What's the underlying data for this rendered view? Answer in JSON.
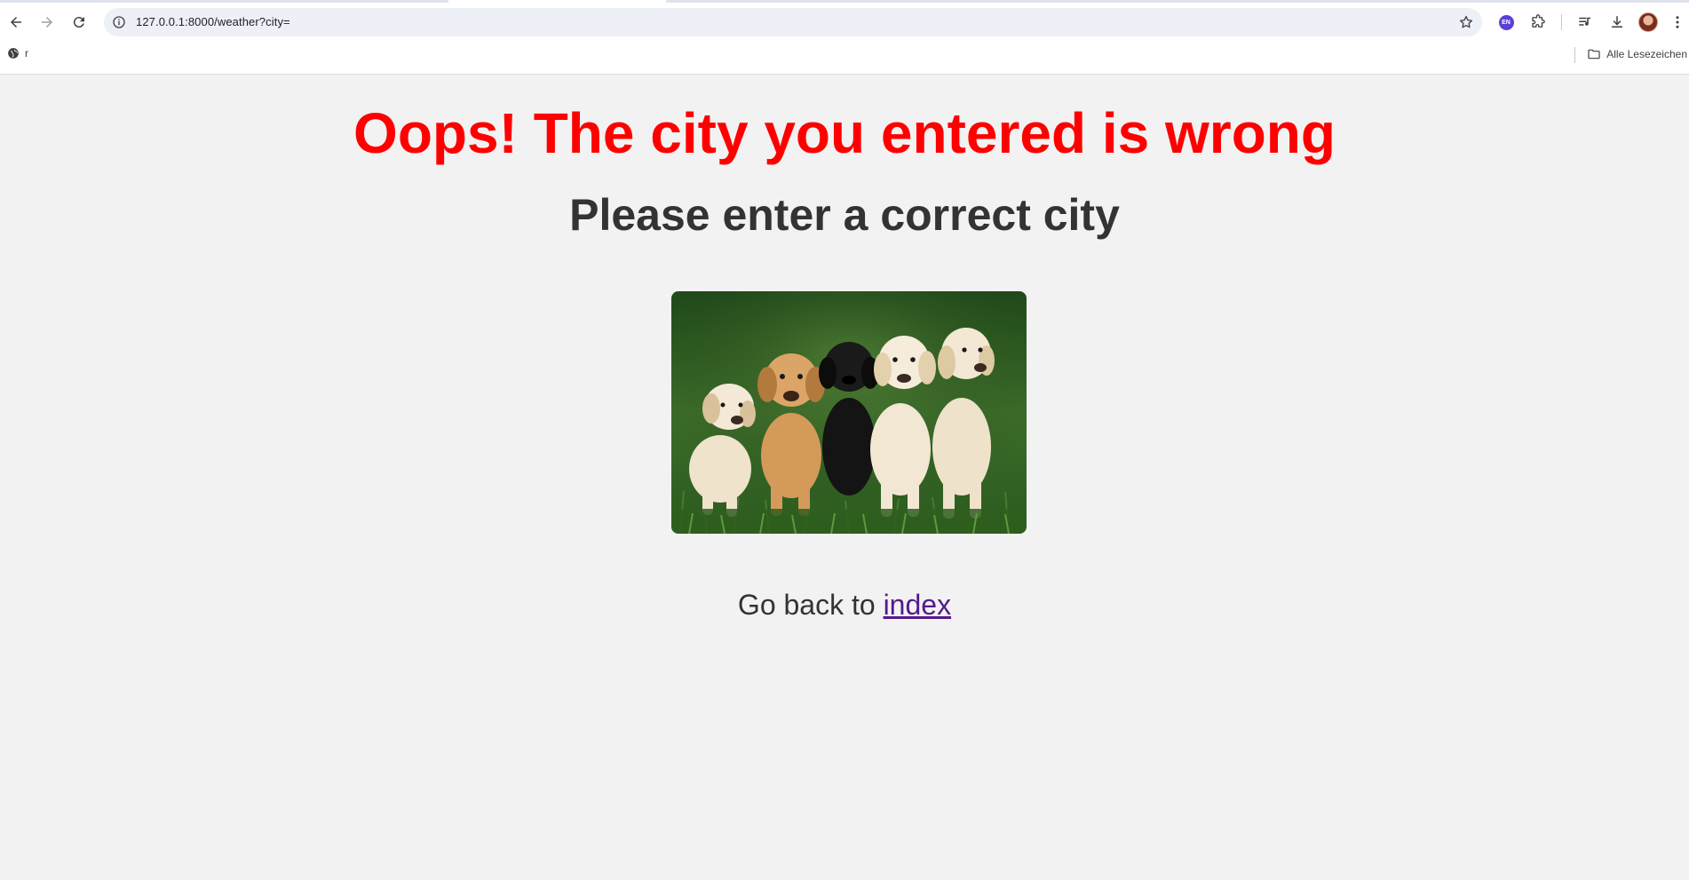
{
  "browser": {
    "url": "127.0.0.1:8000/weather?city=",
    "bookmark_label": "r",
    "all_bookmarks_label": "Alle Lesezeichen",
    "language_badge": "EN"
  },
  "page": {
    "headline": "Oops! The city you entered is wrong",
    "subheadline": "Please enter a correct city",
    "back_text": "Go back to ",
    "back_link_label": "index",
    "image_subject": "puppies"
  },
  "colors": {
    "headline": "#ff0000",
    "subheadline": "#333333",
    "link": "#551a8b",
    "page_background": "#f2f2f2"
  }
}
